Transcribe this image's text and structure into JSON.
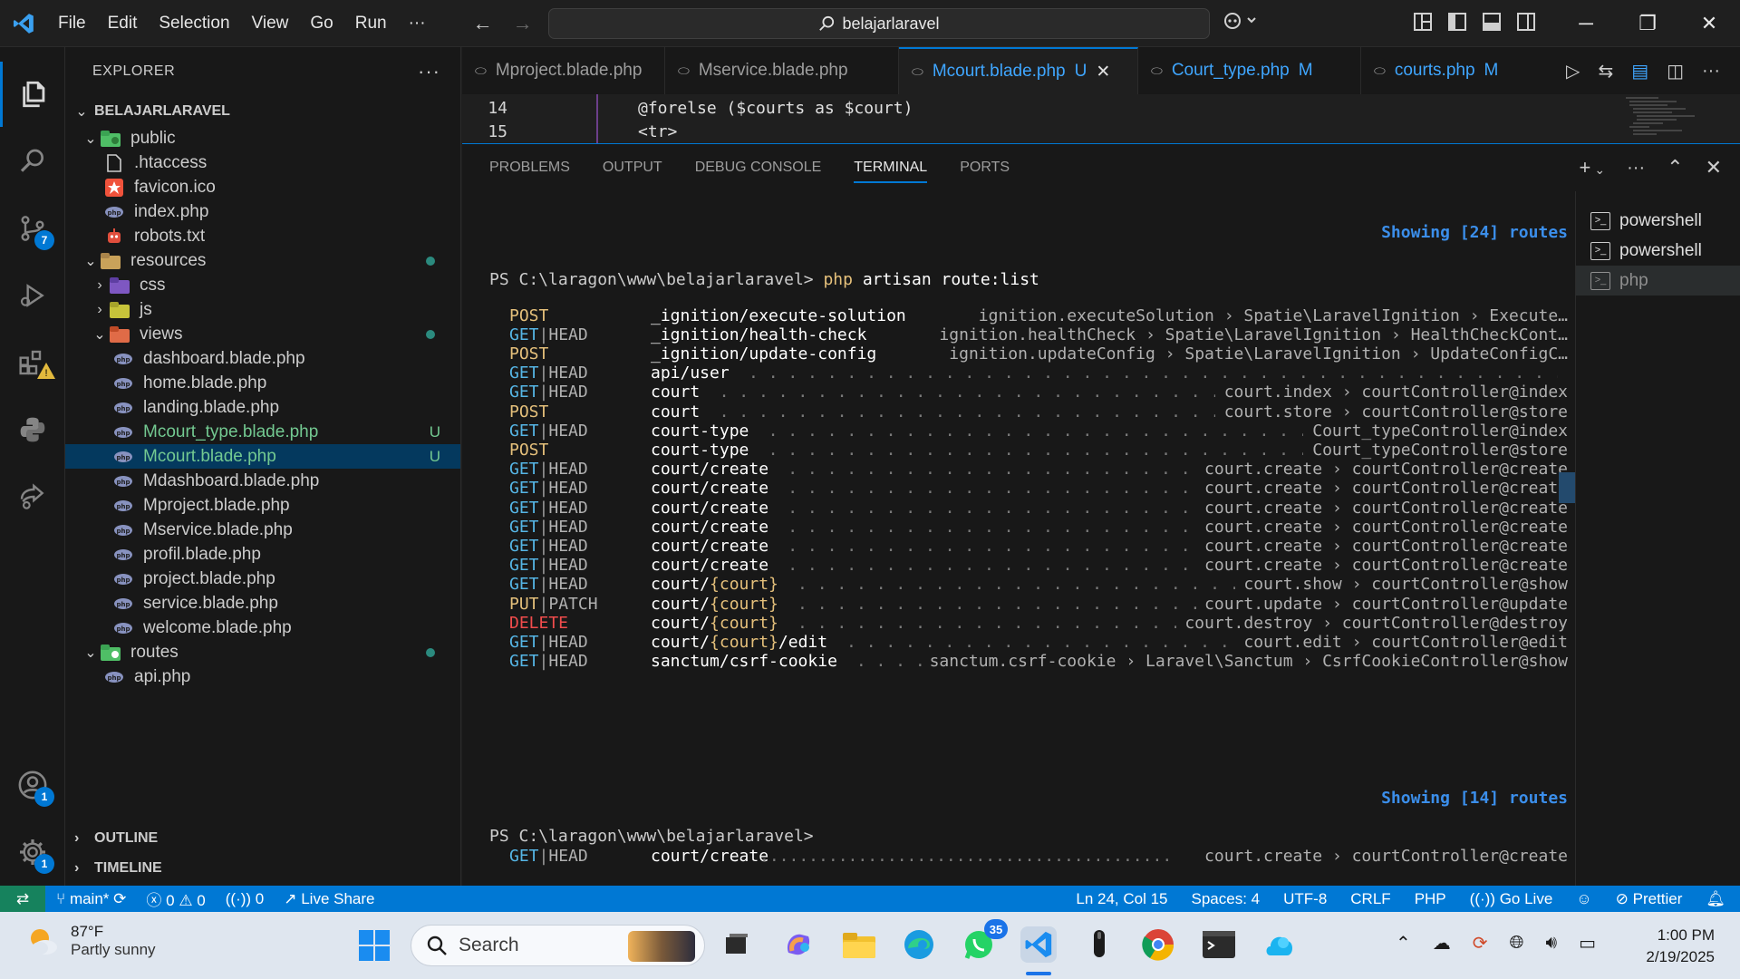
{
  "titlebar": {
    "menu": [
      "File",
      "Edit",
      "Selection",
      "View",
      "Go",
      "Run",
      "···"
    ],
    "search_text": "belajarlaravel"
  },
  "activity": {
    "source_control_badge": "7",
    "accounts_badge": "1",
    "settings_badge": "1"
  },
  "explorer": {
    "title": "EXPLORER",
    "root": "BELAJARLARAVEL",
    "items": [
      {
        "label": "public",
        "kind": "folder-open",
        "depth": 1
      },
      {
        "label": ".htaccess",
        "kind": "file",
        "depth": 2
      },
      {
        "label": "favicon.ico",
        "kind": "file",
        "depth": 2
      },
      {
        "label": "index.php",
        "kind": "file",
        "depth": 2
      },
      {
        "label": "robots.txt",
        "kind": "file",
        "depth": 2
      },
      {
        "label": "resources",
        "kind": "folder-open",
        "depth": 1
      },
      {
        "label": "css",
        "kind": "folder",
        "depth": 2
      },
      {
        "label": "js",
        "kind": "folder",
        "depth": 2
      },
      {
        "label": "views",
        "kind": "folder-open",
        "depth": 2
      },
      {
        "label": "dashboard.blade.php",
        "kind": "file",
        "depth": 3
      },
      {
        "label": "home.blade.php",
        "kind": "file",
        "depth": 3
      },
      {
        "label": "landing.blade.php",
        "kind": "file",
        "depth": 3
      },
      {
        "label": "Mcourt_type.blade.php",
        "kind": "file",
        "depth": 3,
        "status": "U"
      },
      {
        "label": "Mcourt.blade.php",
        "kind": "file",
        "depth": 3,
        "status": "U"
      },
      {
        "label": "Mdashboard.blade.php",
        "kind": "file",
        "depth": 3
      },
      {
        "label": "Mproject.blade.php",
        "kind": "file",
        "depth": 3
      },
      {
        "label": "Mservice.blade.php",
        "kind": "file",
        "depth": 3
      },
      {
        "label": "profil.blade.php",
        "kind": "file",
        "depth": 3
      },
      {
        "label": "project.blade.php",
        "kind": "file",
        "depth": 3
      },
      {
        "label": "service.blade.php",
        "kind": "file",
        "depth": 3
      },
      {
        "label": "welcome.blade.php",
        "kind": "file",
        "depth": 3
      },
      {
        "label": "routes",
        "kind": "folder-open",
        "depth": 1
      },
      {
        "label": "api.php",
        "kind": "file",
        "depth": 2
      }
    ],
    "outline": "OUTLINE",
    "timeline": "TIMELINE"
  },
  "tabs": [
    {
      "label": "Mproject.blade.php",
      "status": ""
    },
    {
      "label": "Mservice.blade.php",
      "status": ""
    },
    {
      "label": "Mcourt.blade.php",
      "status": "U"
    },
    {
      "label": "Court_type.php",
      "status": "M"
    },
    {
      "label": "courts.php",
      "status": "M"
    }
  ],
  "code": {
    "lines": [
      {
        "num": "14",
        "text": "@forelse ($courts as $court)"
      },
      {
        "num": "15",
        "text": "<tr>"
      }
    ]
  },
  "panel": {
    "tabs": [
      "PROBLEMS",
      "OUTPUT",
      "DEBUG CONSOLE",
      "TERMINAL",
      "PORTS"
    ],
    "active_tab": "TERMINAL"
  },
  "terminal": {
    "showing_top": "Showing [24] routes",
    "prompt": "PS C:\\laragon\\www\\belajarlaravel>",
    "cmd": "php",
    "args": "artisan route:list",
    "routes": [
      {
        "m1": "POST",
        "m2": "",
        "uri": "_ignition/execute-solution",
        "param": "",
        "uri_tail": "",
        "name": "ignition.executeSolution",
        "action": "Spatie\\LaravelIgnition › Execute…",
        "dots": false
      },
      {
        "m1": "GET",
        "m2": "HEAD",
        "uri": "_ignition/health-check",
        "param": "",
        "uri_tail": "",
        "name": "ignition.healthCheck",
        "action": "Spatie\\LaravelIgnition › HealthCheckCont…",
        "dots": false
      },
      {
        "m1": "POST",
        "m2": "",
        "uri": "_ignition/update-config",
        "param": "",
        "uri_tail": "",
        "name": "ignition.updateConfig",
        "action": "Spatie\\LaravelIgnition › UpdateConfigC…",
        "dots": false
      },
      {
        "m1": "GET",
        "m2": "HEAD",
        "uri": "api/user",
        "param": "",
        "uri_tail": "",
        "name": "",
        "action": "",
        "dots": true
      },
      {
        "m1": "GET",
        "m2": "HEAD",
        "uri": "court",
        "param": "",
        "uri_tail": "",
        "name": "court.index",
        "action": "courtController@index",
        "dots": true
      },
      {
        "m1": "POST",
        "m2": "",
        "uri": "court",
        "param": "",
        "uri_tail": "",
        "name": "court.store",
        "action": "courtController@store",
        "dots": true
      },
      {
        "m1": "GET",
        "m2": "HEAD",
        "uri": "court-type",
        "param": "",
        "uri_tail": "",
        "name": "",
        "action": "Court_typeController@index",
        "dots": true
      },
      {
        "m1": "POST",
        "m2": "",
        "uri": "court-type",
        "param": "",
        "uri_tail": "",
        "name": "",
        "action": "Court_typeController@store",
        "dots": true
      },
      {
        "m1": "GET",
        "m2": "HEAD",
        "uri": "court/create",
        "param": "",
        "uri_tail": "",
        "name": "court.create",
        "action": "courtController@create",
        "dots": true
      },
      {
        "m1": "GET",
        "m2": "HEAD",
        "uri": "court/create",
        "param": "",
        "uri_tail": "",
        "name": "court.create",
        "action": "courtController@create",
        "dots": true
      },
      {
        "m1": "GET",
        "m2": "HEAD",
        "uri": "court/create",
        "param": "",
        "uri_tail": "",
        "name": "court.create",
        "action": "courtController@create",
        "dots": true
      },
      {
        "m1": "GET",
        "m2": "HEAD",
        "uri": "court/create",
        "param": "",
        "uri_tail": "",
        "name": "court.create",
        "action": "courtController@create",
        "dots": true
      },
      {
        "m1": "GET",
        "m2": "HEAD",
        "uri": "court/create",
        "param": "",
        "uri_tail": "",
        "name": "court.create",
        "action": "courtController@create",
        "dots": true
      },
      {
        "m1": "GET",
        "m2": "HEAD",
        "uri": "court/create",
        "param": "",
        "uri_tail": "",
        "name": "court.create",
        "action": "courtController@create",
        "dots": true
      },
      {
        "m1": "GET",
        "m2": "HEAD",
        "uri": "court/",
        "param": "{court}",
        "uri_tail": "",
        "name": "court.show",
        "action": "courtController@show",
        "dots": true
      },
      {
        "m1": "PUT",
        "m2": "PATCH",
        "uri": "court/",
        "param": "{court}",
        "uri_tail": "",
        "name": "court.update",
        "action": "courtController@update",
        "dots": true
      },
      {
        "m1": "DELETE",
        "m2": "",
        "uri": "court/",
        "param": "{court}",
        "uri_tail": "",
        "name": "court.destroy",
        "action": "courtController@destroy",
        "dots": true
      },
      {
        "m1": "GET",
        "m2": "HEAD",
        "uri": "court/",
        "param": "{court}",
        "uri_tail": "/edit",
        "name": "court.edit",
        "action": "courtController@edit",
        "dots": true
      },
      {
        "m1": "GET",
        "m2": "HEAD",
        "uri": "sanctum/csrf-cookie",
        "param": "",
        "uri_tail": "",
        "name": "sanctum.csrf-cookie",
        "action": "Laravel\\Sanctum › CsrfCookieController@show",
        "dots": true
      }
    ],
    "showing_bottom": "Showing [14] routes",
    "prompt2": "PS C:\\laragon\\www\\belajarlaravel>",
    "last_route": {
      "m1": "GET",
      "m2": "HEAD",
      "uri": "court/create",
      "name": "court.create",
      "action": "courtController@create"
    }
  },
  "terminals": [
    {
      "label": "powershell",
      "active": false
    },
    {
      "label": "powershell",
      "active": false
    },
    {
      "label": "php",
      "active": true
    }
  ],
  "statusbar": {
    "branch": "main*",
    "errors": "0",
    "warnings": "0",
    "ports": "0",
    "live_share": "Live Share",
    "position": "Ln 24, Col 15",
    "spaces": "Spaces: 4",
    "encoding": "UTF-8",
    "eol": "CRLF",
    "language": "PHP",
    "go_live": "Go Live",
    "prettier": "Prettier"
  },
  "taskbar": {
    "temp": "87°F",
    "condition": "Partly sunny",
    "search": "Search",
    "whatsapp_badge": "35",
    "time": "1:00 PM",
    "date": "2/19/2025"
  }
}
